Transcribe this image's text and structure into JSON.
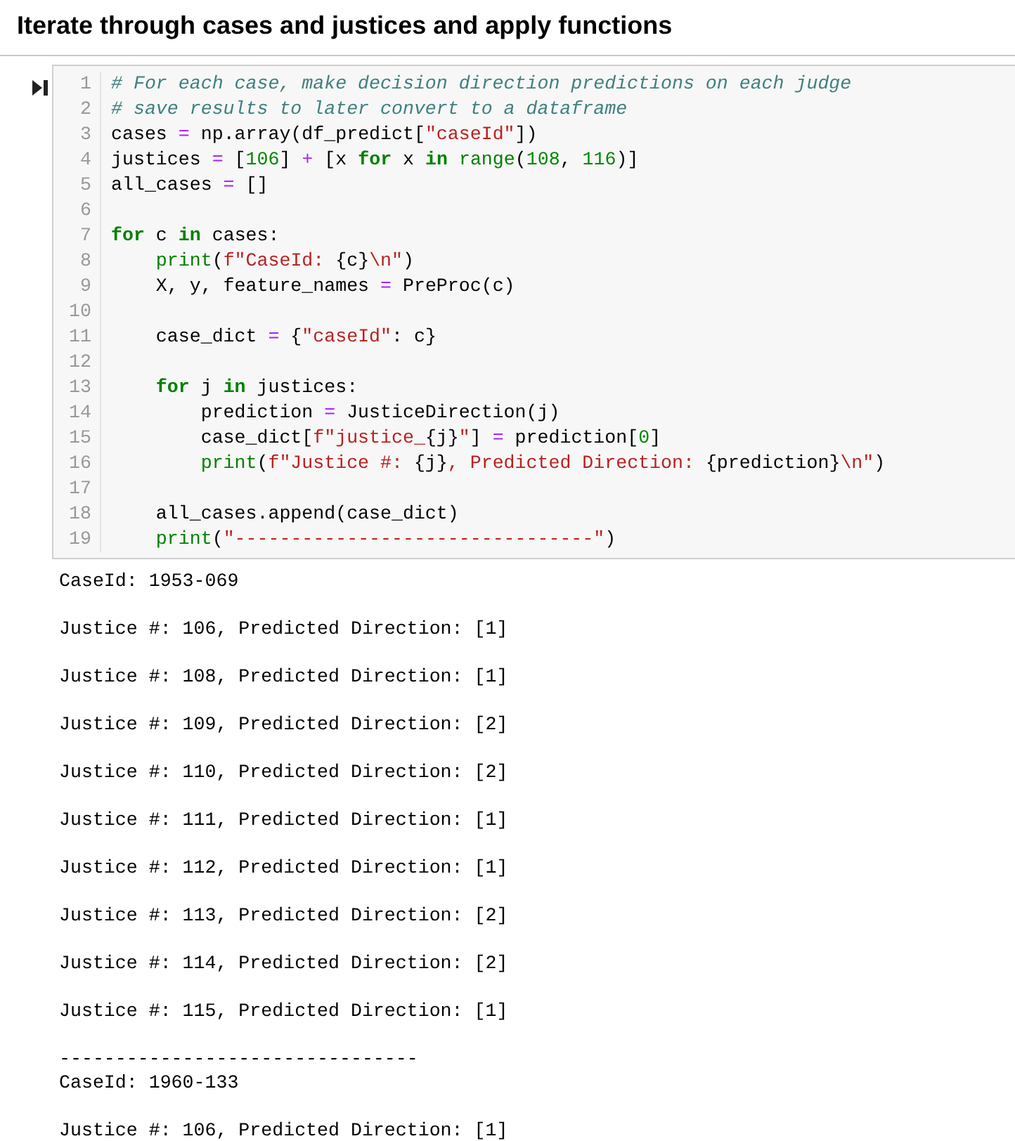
{
  "heading": "Iterate through cases and justices and apply functions",
  "code_cell": {
    "lines": [
      {
        "number": "1",
        "tokens": [
          {
            "kind": "comment",
            "text": "# For each case, make decision direction predictions on each judge"
          }
        ]
      },
      {
        "number": "2",
        "tokens": [
          {
            "kind": "comment",
            "text": "# save results to later convert to a dataframe"
          }
        ]
      },
      {
        "number": "3",
        "tokens": [
          {
            "kind": "name",
            "text": "cases "
          },
          {
            "kind": "operator",
            "text": "="
          },
          {
            "kind": "name",
            "text": " np.array(df_predict["
          },
          {
            "kind": "string",
            "text": "\"caseId\""
          },
          {
            "kind": "name",
            "text": "])"
          }
        ]
      },
      {
        "number": "4",
        "tokens": [
          {
            "kind": "name",
            "text": "justices "
          },
          {
            "kind": "operator",
            "text": "="
          },
          {
            "kind": "name",
            "text": " ["
          },
          {
            "kind": "number",
            "text": "106"
          },
          {
            "kind": "name",
            "text": "] "
          },
          {
            "kind": "operator",
            "text": "+"
          },
          {
            "kind": "name",
            "text": " [x "
          },
          {
            "kind": "keyword",
            "text": "for"
          },
          {
            "kind": "name",
            "text": " x "
          },
          {
            "kind": "keyword",
            "text": "in"
          },
          {
            "kind": "builtin",
            "text": " range"
          },
          {
            "kind": "name",
            "text": "("
          },
          {
            "kind": "number",
            "text": "108"
          },
          {
            "kind": "name",
            "text": ", "
          },
          {
            "kind": "number",
            "text": "116"
          },
          {
            "kind": "name",
            "text": ")]"
          }
        ]
      },
      {
        "number": "5",
        "tokens": [
          {
            "kind": "name",
            "text": "all_cases "
          },
          {
            "kind": "operator",
            "text": "="
          },
          {
            "kind": "name",
            "text": " []"
          }
        ]
      },
      {
        "number": "6"
      },
      {
        "number": "7",
        "tokens": [
          {
            "kind": "keyword",
            "text": "for"
          },
          {
            "kind": "name",
            "text": " c "
          },
          {
            "kind": "keyword",
            "text": "in"
          },
          {
            "kind": "name",
            "text": " cases:"
          }
        ]
      },
      {
        "number": "8",
        "tokens": [
          {
            "kind": "builtin",
            "text": "    print"
          },
          {
            "kind": "name",
            "text": "("
          },
          {
            "kind": "string",
            "text": "f\"CaseId: "
          },
          {
            "kind": "name",
            "text": "{c}"
          },
          {
            "kind": "string",
            "text": "\\n\""
          },
          {
            "kind": "name",
            "text": ")"
          }
        ]
      },
      {
        "number": "9",
        "tokens": [
          {
            "kind": "name",
            "text": "    X, y, feature_names "
          },
          {
            "kind": "operator",
            "text": "="
          },
          {
            "kind": "name",
            "text": " PreProc(c)"
          }
        ]
      },
      {
        "number": "10"
      },
      {
        "number": "11",
        "tokens": [
          {
            "kind": "name",
            "text": "    case_dict "
          },
          {
            "kind": "operator",
            "text": "="
          },
          {
            "kind": "name",
            "text": " {"
          },
          {
            "kind": "string",
            "text": "\"caseId\""
          },
          {
            "kind": "name",
            "text": ": c}"
          }
        ]
      },
      {
        "number": "12"
      },
      {
        "number": "13",
        "tokens": [
          {
            "kind": "keyword",
            "text": "    for"
          },
          {
            "kind": "name",
            "text": " j "
          },
          {
            "kind": "keyword",
            "text": "in"
          },
          {
            "kind": "name",
            "text": " justices:"
          }
        ]
      },
      {
        "number": "14",
        "tokens": [
          {
            "kind": "name",
            "text": "        prediction "
          },
          {
            "kind": "operator",
            "text": "="
          },
          {
            "kind": "name",
            "text": " JusticeDirection(j)"
          }
        ]
      },
      {
        "number": "15",
        "tokens": [
          {
            "kind": "name",
            "text": "        case_dict["
          },
          {
            "kind": "string",
            "text": "f\"justice_"
          },
          {
            "kind": "name",
            "text": "{j}"
          },
          {
            "kind": "string",
            "text": "\""
          },
          {
            "kind": "name",
            "text": "] "
          },
          {
            "kind": "operator",
            "text": "="
          },
          {
            "kind": "name",
            "text": " prediction["
          },
          {
            "kind": "number",
            "text": "0"
          },
          {
            "kind": "name",
            "text": "]"
          }
        ]
      },
      {
        "number": "16",
        "tokens": [
          {
            "kind": "builtin",
            "text": "        print"
          },
          {
            "kind": "name",
            "text": "("
          },
          {
            "kind": "string",
            "text": "f\"Justice #: "
          },
          {
            "kind": "name",
            "text": "{j}"
          },
          {
            "kind": "string",
            "text": ", Predicted Direction: "
          },
          {
            "kind": "name",
            "text": "{prediction}"
          },
          {
            "kind": "string",
            "text": "\\n\""
          },
          {
            "kind": "name",
            "text": ")"
          }
        ]
      },
      {
        "number": "17"
      },
      {
        "number": "18",
        "tokens": [
          {
            "kind": "name",
            "text": "    all_cases.append(case_dict)"
          }
        ]
      },
      {
        "number": "19",
        "tokens": [
          {
            "kind": "builtin",
            "text": "    print"
          },
          {
            "kind": "name",
            "text": "("
          },
          {
            "kind": "string",
            "text": "\"--------------------------------\""
          },
          {
            "kind": "name",
            "text": ")"
          }
        ]
      }
    ]
  },
  "output": [
    {
      "kind": "message",
      "text": "CaseId: 1953-069"
    },
    {
      "kind": "message",
      "text": "Justice #: 106, Predicted Direction: [1]"
    },
    {
      "kind": "message",
      "text": "Justice #: 108, Predicted Direction: [1]"
    },
    {
      "kind": "message",
      "text": "Justice #: 109, Predicted Direction: [2]"
    },
    {
      "kind": "message",
      "text": "Justice #: 110, Predicted Direction: [2]"
    },
    {
      "kind": "message",
      "text": "Justice #: 111, Predicted Direction: [1]"
    },
    {
      "kind": "message",
      "text": "Justice #: 112, Predicted Direction: [1]"
    },
    {
      "kind": "message",
      "text": "Justice #: 113, Predicted Direction: [2]"
    },
    {
      "kind": "message",
      "text": "Justice #: 114, Predicted Direction: [2]"
    },
    {
      "kind": "message",
      "text": "Justice #: 115, Predicted Direction: [1]"
    },
    {
      "kind": "separator",
      "text": "--------------------------------"
    },
    {
      "kind": "message",
      "text": "CaseId: 1960-133"
    },
    {
      "kind": "message",
      "text": "Justice #: 106, Predicted Direction: [1]"
    }
  ]
}
